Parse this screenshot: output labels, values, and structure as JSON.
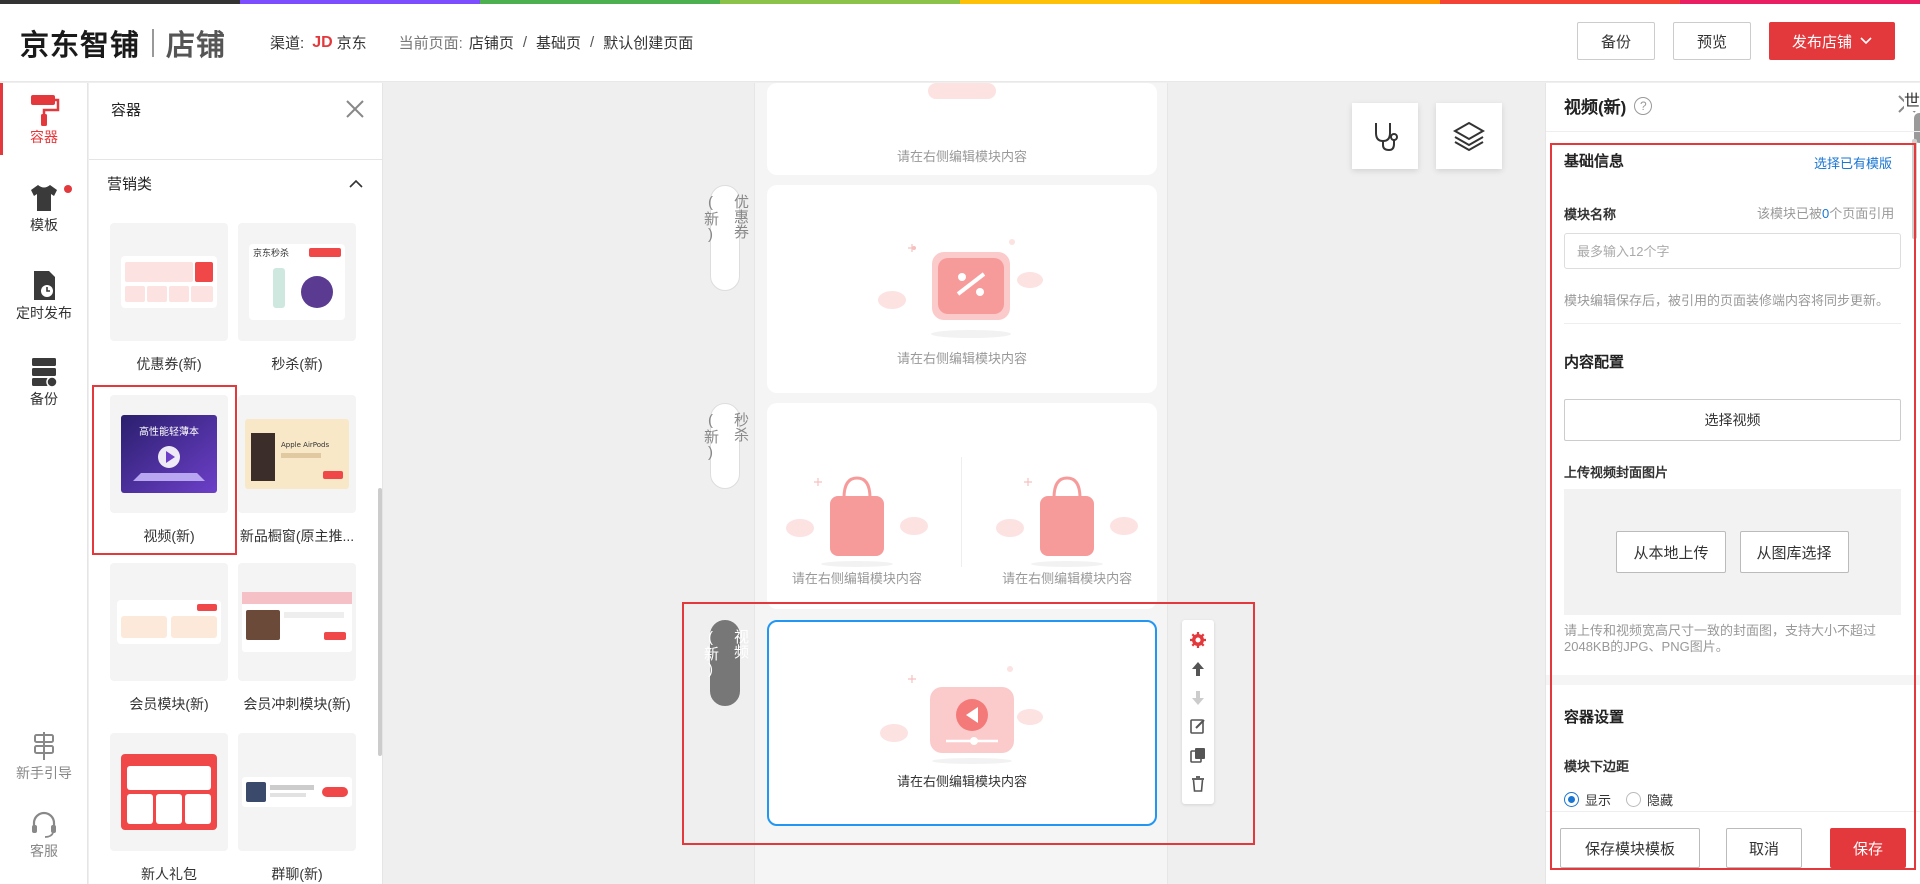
{
  "colors": {
    "brand_red": "#e4393c",
    "link_blue": "#1976d2",
    "selection_blue": "#2196f3",
    "rainbow": [
      "#333333",
      "#7c4dff",
      "#4caf50",
      "#8bc34a",
      "#ffc107",
      "#ff9800",
      "#f44336",
      "#e91e63"
    ]
  },
  "header": {
    "logo_main": "京东智铺",
    "logo_sub": "店铺",
    "channel_label": "渠道:",
    "channel_jd": "JD",
    "channel_name": "京东",
    "current_page_label": "当前页面:",
    "crumbs": [
      "店铺页",
      "基础页",
      "默认创建页面"
    ],
    "buttons": {
      "backup": "备份",
      "preview": "预览",
      "publish": "发布店铺"
    }
  },
  "rail": {
    "items": [
      {
        "label": "容器",
        "icon": "paint-roller-icon"
      },
      {
        "label": "模板",
        "icon": "tshirt-icon"
      },
      {
        "label": "定时发布",
        "icon": "scheduled-doc-icon"
      },
      {
        "label": "备份",
        "icon": "server-backup-icon"
      },
      {
        "label": "新手引导",
        "icon": "signpost-icon"
      },
      {
        "label": "客服",
        "icon": "headset-icon"
      }
    ]
  },
  "panel": {
    "title": "容器",
    "category": "营销类",
    "tiles": [
      {
        "label": "优惠券(新)"
      },
      {
        "label": "秒杀(新)",
        "thumb_text": "京东秒杀"
      },
      {
        "label": "视频(新)",
        "thumb_text": "高性能轻薄本"
      },
      {
        "label": "新品橱窗(原主推...",
        "thumb_text": "Apple AirPods"
      },
      {
        "label": "会员模块(新)"
      },
      {
        "label": "会员冲刺模块(新)"
      },
      {
        "label": "新人礼包"
      },
      {
        "label": "群聊(新)"
      }
    ]
  },
  "canvas": {
    "hint": "请在右侧编辑模块内容",
    "tags": {
      "coupon": "优惠券(新)",
      "seckill": "秒杀(新)",
      "video": "视频(新)"
    }
  },
  "settings": {
    "title": "视频(新)",
    "world_char": "世",
    "basic_info": "基础信息",
    "choose_template": "选择已有模版",
    "module_name_label": "模块名称",
    "ref_prefix": "该模块已被",
    "ref_count": "0",
    "ref_suffix": "个页面引用",
    "name_placeholder": "最多输入12个字",
    "sync_note": "模块编辑保存后，被引用的页面装修端内容将同步更新。",
    "content_config": "内容配置",
    "choose_video": "选择视频",
    "cover_label": "上传视频封面图片",
    "upload_local": "从本地上传",
    "upload_gallery": "从图库选择",
    "cover_note": "请上传和视频宽高尺寸一致的封面图，支持大小不超过2048KB的JPG、PNG图片。",
    "container_settings": "容器设置",
    "bottom_margin_label": "模块下边距",
    "radio_show": "显示",
    "radio_hide": "隐藏",
    "save_template": "保存模块模板",
    "cancel": "取消",
    "save": "保存"
  }
}
